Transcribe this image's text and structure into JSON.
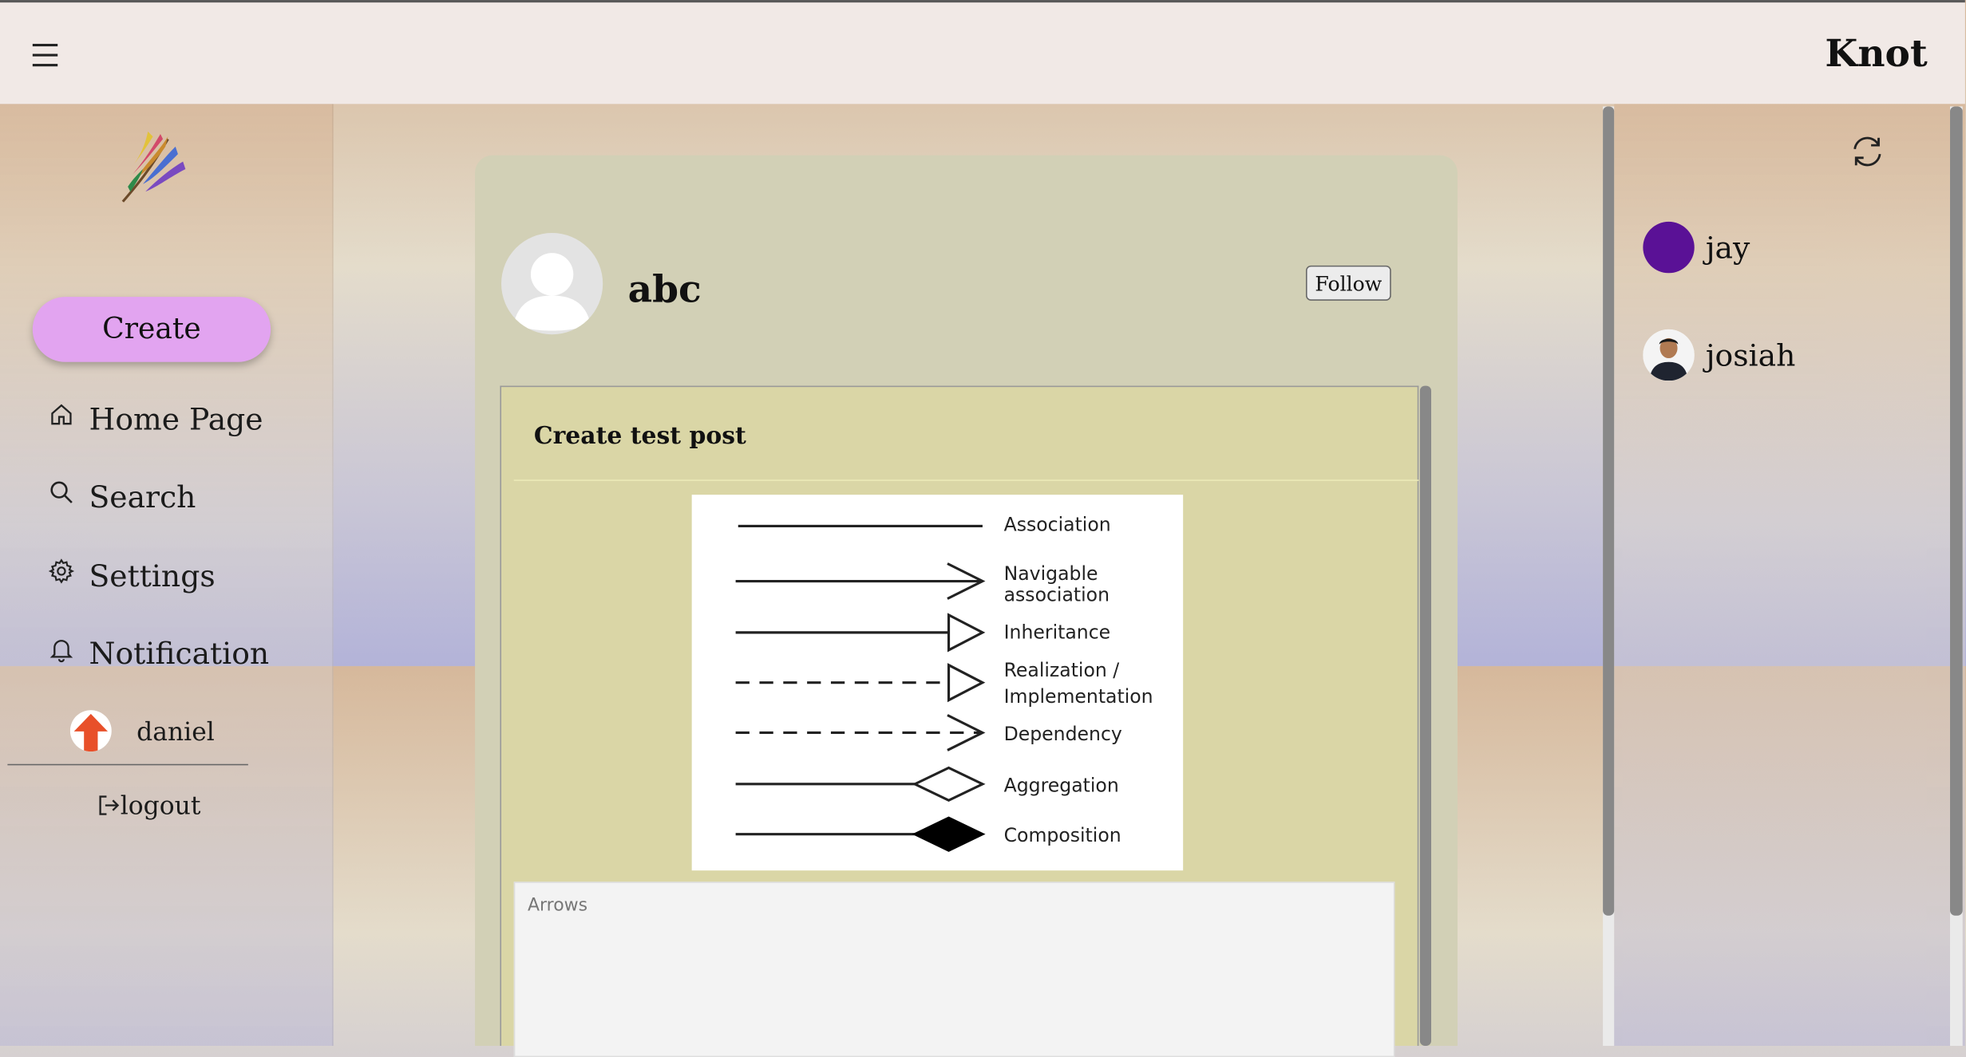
{
  "app": {
    "brand": "Knot"
  },
  "sidebar": {
    "create_label": "Create",
    "items": [
      {
        "label": "Home Page",
        "icon": "home-icon"
      },
      {
        "label": "Search",
        "icon": "search-icon"
      },
      {
        "label": "Settings",
        "icon": "gear-icon"
      },
      {
        "label": "Notification",
        "icon": "bell-icon"
      }
    ],
    "user": {
      "name": "daniel"
    },
    "logout_label": "logout"
  },
  "profile": {
    "name": "abc",
    "follow_label": "Follow"
  },
  "post": {
    "title": "Create test post",
    "image_labels": {
      "association": "Association",
      "navigable_1": "Navigable",
      "navigable_2": "association",
      "inheritance": "Inheritance",
      "realization_1": "Realization /",
      "realization_2": "Implementation",
      "dependency": "Dependency",
      "aggregation": "Aggregation",
      "composition": "Composition"
    },
    "caption": "Arrows"
  },
  "right_panel": {
    "users": [
      {
        "name": "jay"
      },
      {
        "name": "josiah"
      }
    ]
  },
  "colors": {
    "create_button": "#e2a4f0",
    "topbar": "#f1e9e6",
    "card": "#d2d0b6",
    "post": "#dad6a6",
    "jay_avatar": "#5a1196"
  }
}
